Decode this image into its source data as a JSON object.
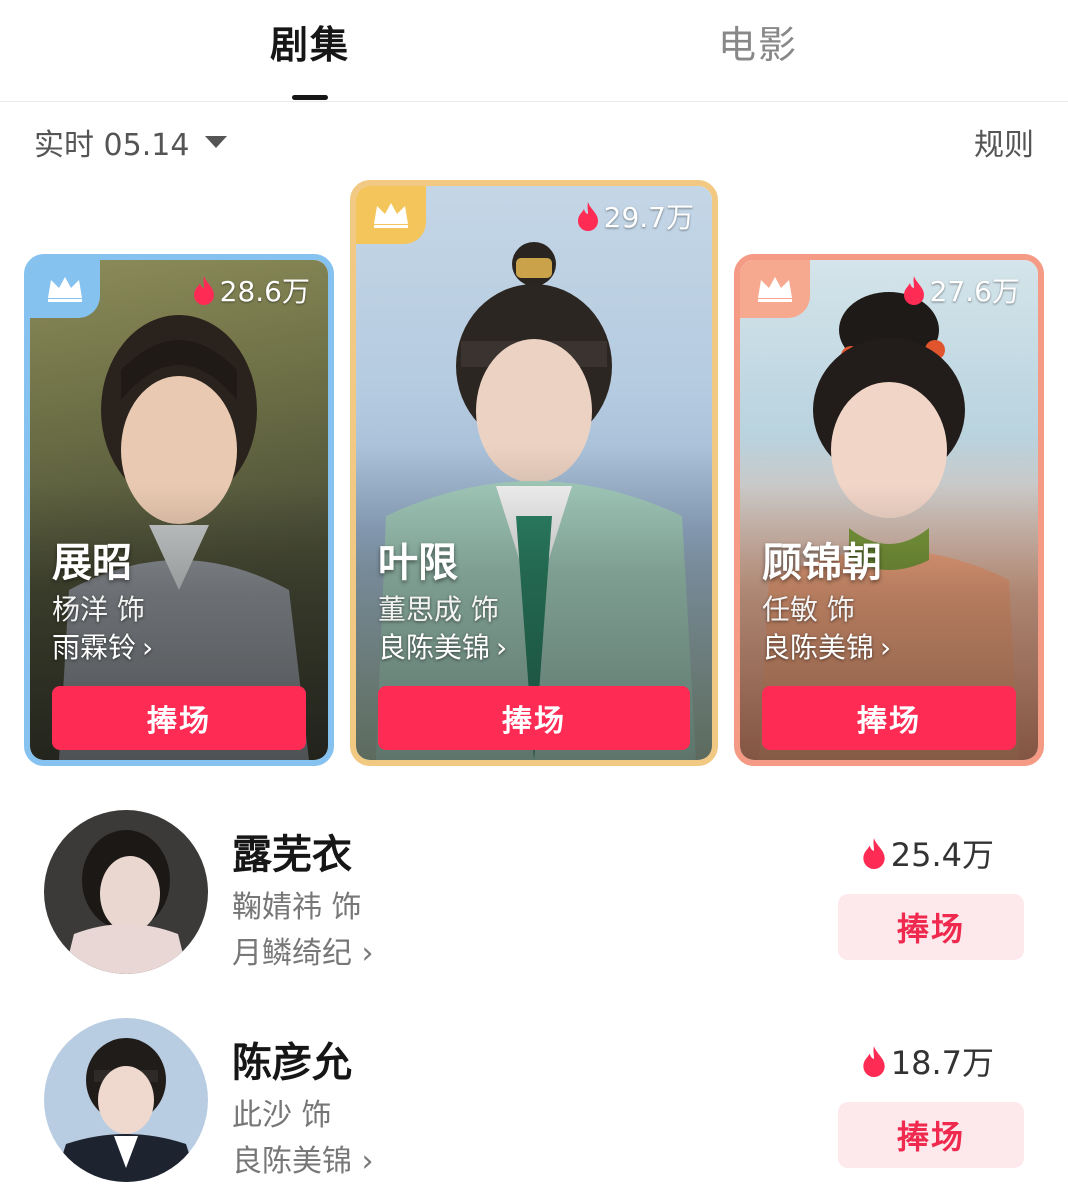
{
  "tabs": {
    "series": "剧集",
    "movies": "电影"
  },
  "subheader": {
    "date_label": "实时 05.14",
    "rules_label": "规则"
  },
  "top_cards": [
    {
      "role": "展昭",
      "actor": "杨洋 饰",
      "show": "雨霖铃",
      "heat": "28.6万",
      "button": "捧场",
      "rank": 2,
      "accent": "#86c2ef"
    },
    {
      "role": "叶限",
      "actor": "董思成 饰",
      "show": "良陈美锦",
      "heat": "29.7万",
      "button": "捧场",
      "rank": 1,
      "accent": "#f4c55a"
    },
    {
      "role": "顾锦朝",
      "actor": "任敏 饰",
      "show": "良陈美锦",
      "heat": "27.6万",
      "button": "捧场",
      "rank": 3,
      "accent": "#f7a98f"
    }
  ],
  "list": [
    {
      "role": "露芜衣",
      "actor": "鞠婧祎 饰",
      "show": "月鳞绮纪",
      "heat": "25.4万",
      "button": "捧场"
    },
    {
      "role": "陈彦允",
      "actor": "此沙 饰",
      "show": "良陈美锦",
      "heat": "18.7万",
      "button": "捧场"
    }
  ],
  "icons": {
    "crown": "crown-icon",
    "fire": "fire-icon",
    "chevron": "chevron-right-icon",
    "caret": "caret-down-icon"
  },
  "colors": {
    "primary": "#fe2c55",
    "soft_button": "#fde8ec",
    "soft_button_text": "#f0294e"
  }
}
